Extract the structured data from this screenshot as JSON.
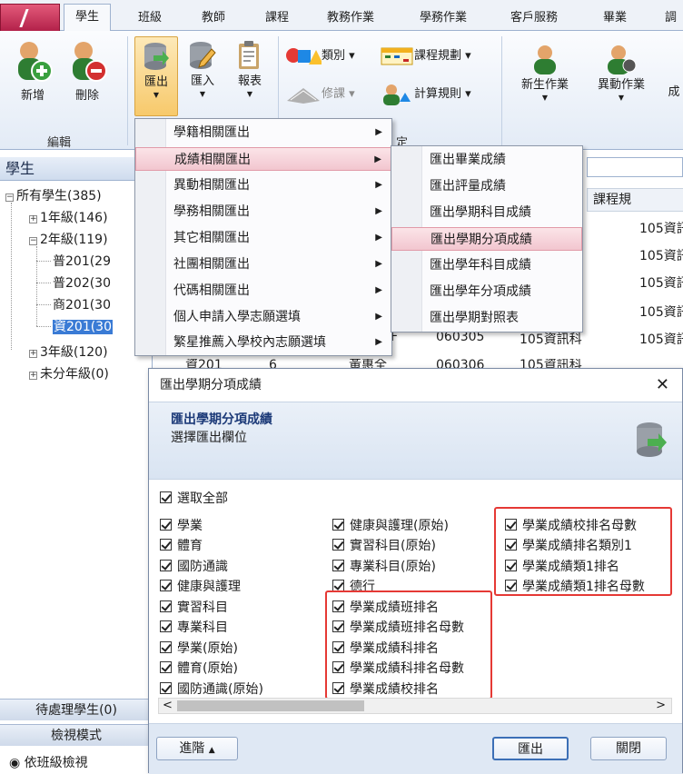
{
  "tabs": [
    "學生",
    "班級",
    "教師",
    "課程",
    "教務作業",
    "學務作業",
    "客戶服務",
    "畢業",
    "調"
  ],
  "ribbon": {
    "edit_group": {
      "add": "新增",
      "delete": "刪除",
      "label": "編輯"
    },
    "export": "匯出",
    "import": "匯入",
    "report": "報表",
    "category": "類別",
    "course_plan": "課程規劃",
    "retake": "修課",
    "calc_rule": "計算規則",
    "new_student": "新生作業",
    "transfer": "異動作業",
    "cheng": "成",
    "group_partial": "定"
  },
  "left_pane": {
    "title": "學生",
    "tree": [
      {
        "toggle": "−",
        "label": "所有學生(385)"
      },
      {
        "toggle": "+",
        "label": "1年級(146)"
      },
      {
        "toggle": "−",
        "label": "2年級(119)"
      },
      {
        "label": "普201(29"
      },
      {
        "label": "普202(30"
      },
      {
        "label": "商201(30"
      },
      {
        "label": "資201(30"
      },
      {
        "toggle": "+",
        "label": "3年級(120)"
      },
      {
        "toggle": "+",
        "label": "未分年級(0)"
      }
    ],
    "pending": "待處理學生(0)",
    "view_mode": "檢視模式",
    "by_class": "依班級檢視"
  },
  "grid": {
    "header": "課程規",
    "rows": [
      "105資訊",
      "105資訊",
      "105資訊",
      "105資訊",
      "105資訊科"
    ],
    "row_ids": [
      "060305",
      "060306"
    ],
    "row_extra": [
      "資201",
      "6",
      "黃惠全",
      "105資訊科"
    ],
    "row_fragments": [
      "科",
      "科",
      "科",
      "科",
      "F"
    ]
  },
  "export_menu": [
    "學籍相關匯出",
    "成績相關匯出",
    "異動相關匯出",
    "學務相關匯出",
    "其它相關匯出",
    "社團相關匯出",
    "代碼相關匯出",
    "個人申請入學志願選填",
    "繁星推薦入學校內志願選填"
  ],
  "grades_submenu": [
    "匯出畢業成績",
    "匯出評量成績",
    "匯出學期科目成績",
    "匯出學期分項成績",
    "匯出學年科目成績",
    "匯出學年分項成績",
    "匯出學期對照表"
  ],
  "dialog": {
    "title": "匯出學期分項成績",
    "header_title": "匯出學期分項成績",
    "header_sub": "選擇匯出欄位",
    "select_all": "選取全部",
    "col1": [
      "學業",
      "體育",
      "國防通識",
      "健康與護理",
      "實習科目",
      "專業科目",
      "學業(原始)",
      "體育(原始)",
      "國防通識(原始)"
    ],
    "col2": [
      "健康與護理(原始)",
      "實習科目(原始)",
      "專業科目(原始)",
      "德行",
      "學業成績班排名",
      "學業成績班排名母數",
      "學業成績科排名",
      "學業成績科排名母數",
      "學業成績校排名"
    ],
    "col3": [
      "學業成績校排名母數",
      "學業成績排名類別1",
      "學業成績類1排名",
      "學業成績類1排名母數"
    ],
    "advanced": "進階",
    "export_btn": "匯出",
    "close_btn": "關閉"
  },
  "colors": {
    "highlight": "#e53935",
    "accent": "#3a7bd5",
    "app_button": "#c8325b"
  }
}
